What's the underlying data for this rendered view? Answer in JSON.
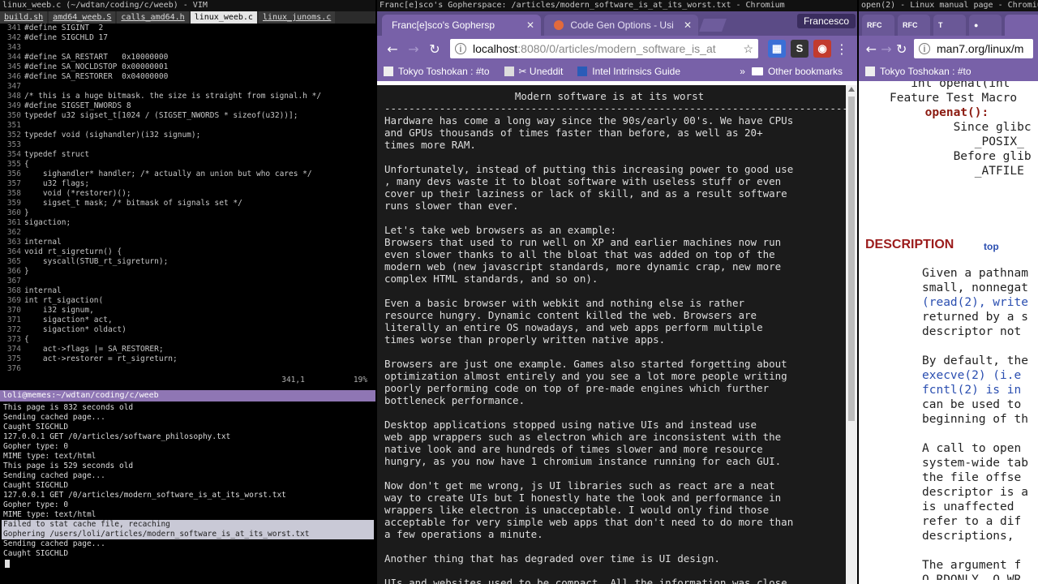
{
  "left": {
    "window_title": "linux_weeb.c (~/wdtan/coding/c/weeb) - VIM",
    "vim_tabs": [
      "build.sh",
      "amd64_weeb.S",
      "calls_amd64.h",
      "linux_weeb.c",
      "linux_junoms.c"
    ],
    "vim_active_tab": 3,
    "vim_lines": [
      {
        "n": "341",
        "code": "#define SIGINT  2"
      },
      {
        "n": "342",
        "code": "#define SIGCHLD 17"
      },
      {
        "n": "343",
        "code": ""
      },
      {
        "n": "344",
        "code": "#define SA_RESTART   0x10000000"
      },
      {
        "n": "345",
        "code": "#define SA_NOCLDSTOP 0x00000001"
      },
      {
        "n": "346",
        "code": "#define SA_RESTORER  0x04000000"
      },
      {
        "n": "347",
        "code": ""
      },
      {
        "n": "348",
        "code": "/* this is a huge bitmask. the size is straight from signal.h */"
      },
      {
        "n": "349",
        "code": "#define SIGSET_NWORDS 8"
      },
      {
        "n": "350",
        "code": "typedef u32 sigset_t[1024 / (SIGSET_NWORDS * sizeof(u32))];"
      },
      {
        "n": "351",
        "code": ""
      },
      {
        "n": "352",
        "code": "typedef void (sighandler)(i32 signum);"
      },
      {
        "n": "353",
        "code": ""
      },
      {
        "n": "354",
        "code": "typedef struct"
      },
      {
        "n": "355",
        "code": "{"
      },
      {
        "n": "356",
        "code": "    sighandler* handler; /* actually an union but who cares */"
      },
      {
        "n": "357",
        "code": "    u32 flags;"
      },
      {
        "n": "358",
        "code": "    void (*restorer)();"
      },
      {
        "n": "359",
        "code": "    sigset_t mask; /* bitmask of signals set */"
      },
      {
        "n": "360",
        "code": "}"
      },
      {
        "n": "361",
        "code": "sigaction;"
      },
      {
        "n": "362",
        "code": ""
      },
      {
        "n": "363",
        "code": "internal"
      },
      {
        "n": "364",
        "code": "void rt_sigreturn() {"
      },
      {
        "n": "365",
        "code": "    syscall(STUB_rt_sigreturn);"
      },
      {
        "n": "366",
        "code": "}"
      },
      {
        "n": "367",
        "code": ""
      },
      {
        "n": "368",
        "code": "internal"
      },
      {
        "n": "369",
        "code": "int rt_sigaction("
      },
      {
        "n": "370",
        "code": "    i32 signum,"
      },
      {
        "n": "371",
        "code": "    sigaction* act,"
      },
      {
        "n": "372",
        "code": "    sigaction* oldact)"
      },
      {
        "n": "373",
        "code": "{"
      },
      {
        "n": "374",
        "code": "    act->flags |= SA_RESTORER;"
      },
      {
        "n": "375",
        "code": "    act->restorer = rt_sigreturn;"
      },
      {
        "n": "376",
        "code": ""
      }
    ],
    "vim_status_pos": "341,1",
    "vim_status_pct": "19%",
    "terminal_title": "loli@memes:~/wdtan/coding/c/weeb",
    "terminal_lines": [
      {
        "text": "This page is 832 seconds old",
        "sel": false
      },
      {
        "text": "Sending cached page...",
        "sel": false
      },
      {
        "text": "Caught SIGCHLD",
        "sel": false
      },
      {
        "text": "127.0.0.1 GET /0/articles/software_philosophy.txt",
        "sel": false
      },
      {
        "text": "Gopher type: 0",
        "sel": false
      },
      {
        "text": "MIME type: text/html",
        "sel": false
      },
      {
        "text": "This page is 529 seconds old",
        "sel": false
      },
      {
        "text": "Sending cached page...",
        "sel": false
      },
      {
        "text": "Caught SIGCHLD",
        "sel": false
      },
      {
        "text": "127.0.0.1 GET /0/articles/modern_software_is_at_its_worst.txt",
        "sel": false
      },
      {
        "text": "Gopher type: 0",
        "sel": false
      },
      {
        "text": "MIME type: text/html",
        "sel": false
      },
      {
        "text": "Failed to stat cache file, recaching",
        "sel": true
      },
      {
        "text": "Gophering /users/loli/articles/modern_software_is_at_its_worst.txt",
        "sel": true
      },
      {
        "text": "Sending cached page...",
        "sel": false
      },
      {
        "text": "Caught SIGCHLD",
        "sel": false
      }
    ]
  },
  "mid": {
    "window_title": "Franc[e]sco's Gopherspace: /articles/modern_software_is_at_its_worst.txt - Chromium",
    "tabs": [
      "Franc[e]sco's Gophersp",
      "Code Gen Options - Usi"
    ],
    "profile": "Francesco",
    "url_host": "localhost",
    "url_rest": ":8080/0/articles/modern_software_is_at",
    "bookmarks": [
      "Tokyo Toshokan : #to",
      "✂ Uneddit",
      "Intel Intrinsics Guide"
    ],
    "bookmarks_more": "»",
    "other_bookmarks": "Other bookmarks",
    "page_title": "Modern software is at its worst",
    "page_rule": "-------------------------------------------------------------------------------------------",
    "paragraphs": [
      "Hardware has come a long way since the 90s/early 00's. We have CPUs\nand GPUs thousands of times faster than before, as well as 20+\ntimes more RAM.",
      "Unfortunately, instead of putting this increasing power to good use\n, many devs waste it to bloat software with useless stuff or even\ncover up their laziness or lack of skill, and as a result software\nruns slower than ever.",
      "Let's take web browsers as an example:\nBrowsers that used to run well on XP and earlier machines now run\neven slower thanks to all the bloat that was added on top of the\nmodern web (new javascript standards, more dynamic crap, new more\ncomplex HTML standards, and so on).",
      "Even a basic browser with webkit and nothing else is rather\nresource hungry. Dynamic content killed the web. Browsers are\nliterally an entire OS nowadays, and web apps perform multiple\ntimes worse than properly written native apps.",
      "Browsers are just one example. Games also started forgetting about\noptimization almost entirely and you see a lot more people writing\npoorly performing code on top of pre-made engines which further\nbottleneck performance.",
      "Desktop applications stopped using native UIs and instead use\nweb app wrappers such as electron which are inconsistent with the\nnative look and are hundreds of times slower and more resource\nhungry, as you now have 1 chromium instance running for each GUI.",
      "Now don't get me wrong, js UI libraries such as react are a neat\nway to create UIs but I honestly hate the look and performance in\nwrappers like electron is unacceptable. I would only find those\nacceptable for very simple web apps that don't need to do more than\na few operations a minute.",
      "Another thing that has degraded over time is UI design.",
      "UIs and websites used to be compact. All the information was close"
    ]
  },
  "right": {
    "window_title": "open(2) - Linux manual page - Chromium",
    "tabs": [
      "RFC",
      "RFC",
      "T",
      ""
    ],
    "url": "man7.org/linux/m",
    "bookmark": "Tokyo Toshokan : #to",
    "lines_top": [
      "   int openat(int",
      "",
      "Feature Test Macro",
      "",
      "     openat():",
      "         Since glibc",
      "            _POSIX_",
      "         Before glib",
      "            _ATFILE"
    ],
    "description_heading": "DESCRIPTION",
    "top_link": "top",
    "para1": [
      "Given a pathnam",
      "small, nonnegat",
      "(read(2), write",
      "returned by a s",
      "descriptor not"
    ],
    "para2": [
      "By default, the",
      "execve(2) (i.e",
      "fcntl(2) is in",
      "can be used to",
      "beginning of th"
    ],
    "para3": [
      "A call to open",
      "system-wide tab",
      "the file offse",
      "descriptor is a",
      "is unaffected",
      "refer to a dif",
      "descriptions,"
    ],
    "para4": [
      "The argument f",
      "O_RDONLY, O_WR"
    ]
  },
  "colors": {
    "titlebar": "#111111",
    "terminal_title": "#8f76b4",
    "chromium_tabbar": "#5b4b86",
    "chromium_toolbar": "#7861a8",
    "page_bg": "#1b1b1b",
    "man_heading": "#9b1b1b",
    "man_link": "#2a4eb0"
  }
}
